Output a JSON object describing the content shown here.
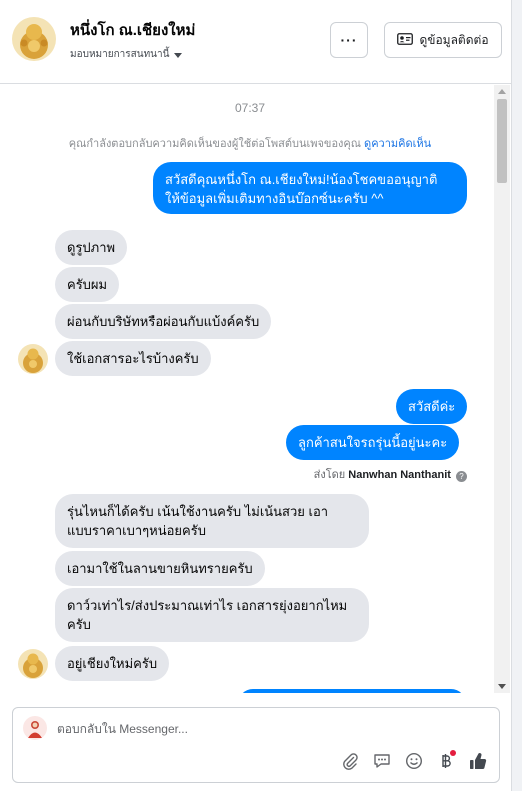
{
  "header": {
    "page_name": "หนึ่งโก ณ.เชียงใหม่",
    "assign_label": "มอบหมายการสนทนานี้",
    "more_label": "···",
    "contact_label": "ดูข้อมูลติดต่อ"
  },
  "thread": {
    "timestamp": "07:37",
    "notice_text": "คุณกำลังตอบกลับความคิดเห็นของผู้ใช้ต่อโพสต์บนเพจของคุณ",
    "notice_link": "ดูความคิดเห็น",
    "messages": [
      {
        "dir": "out",
        "text": "สวัสดีคุณหนึ่งโก ณ.เชียงใหม่!น้องโชคขออนุญาติ"
      },
      {
        "dir": "out",
        "text": "ให้ข้อมูลเพิ่มเติมทางอินบ๊อกซ์นะครับ ^^"
      },
      {
        "dir": "in",
        "text": "ดูรูปภาพ"
      },
      {
        "dir": "in",
        "text": "ครับผม"
      },
      {
        "dir": "in",
        "text": "ผ่อนกับบริษัทหรือผ่อนกับแบ้งค์ครับ"
      },
      {
        "dir": "in",
        "text": "ใช้เอกสารอะไรบ้างครับ"
      },
      {
        "dir": "out",
        "text": "สวัสดีค่ะ"
      },
      {
        "dir": "out",
        "text": "ลูกค้าสนใจรถรุ่นนี้อยู่นะคะ"
      },
      {
        "dir": "in",
        "text": "รุ่นไหนก็ได้ครับ เน้นใช้งานครับ ไม่เน้นสวย เอา"
      },
      {
        "dir": "in",
        "text": "แบบราคาเบาๆหน่อยครับ"
      },
      {
        "dir": "in",
        "text": "เอามาใช้ในลานขายหินทรายครับ"
      },
      {
        "dir": "in",
        "text": "ดาว์วเท่าไร/ส่งประมาณเท่าไร เอกสารยุ่งอยากไหม"
      },
      {
        "dir": "in",
        "text": "ครับ"
      },
      {
        "dir": "in",
        "text": "อยู่เชียงใหม่ครับ"
      }
    ],
    "sent_by_prefix": "ส่งโดย",
    "sent_by_name": "Nanwhan Nanthanit"
  },
  "composer": {
    "placeholder": "ตอบกลับใน Messenger..."
  },
  "colors": {
    "outgoing_bubble": "#0084ff",
    "incoming_bubble": "#e4e6eb",
    "link": "#1b74e4"
  }
}
